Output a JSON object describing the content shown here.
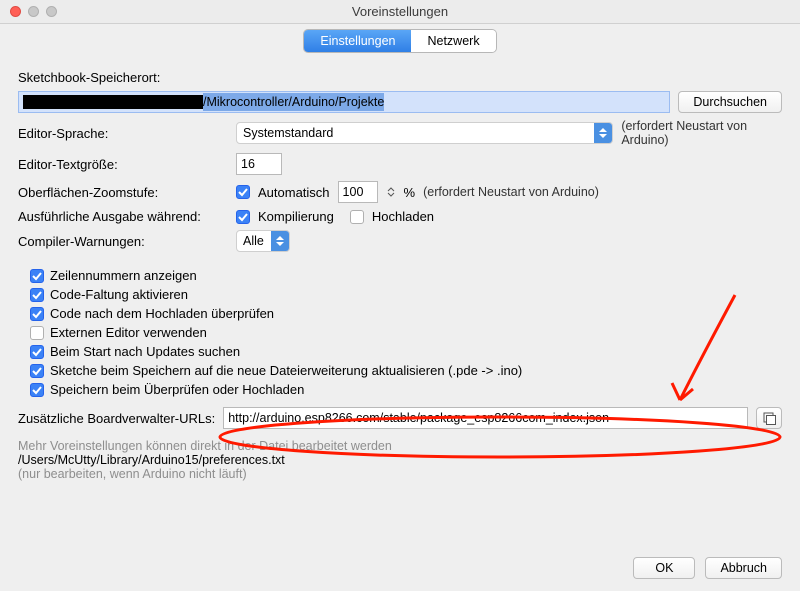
{
  "window": {
    "title": "Voreinstellungen"
  },
  "tabs": {
    "settings": "Einstellungen",
    "network": "Netzwerk"
  },
  "sketchbook": {
    "label": "Sketchbook-Speicherort:",
    "path_suffix": "/Mikrocontroller/Arduino/Projekte",
    "browse": "Durchsuchen"
  },
  "editor": {
    "language_label": "Editor-Sprache:",
    "language_value": "Systemstandard",
    "language_hint": "(erfordert Neustart von Arduino)",
    "fontsize_label": "Editor-Textgröße:",
    "fontsize_value": "16",
    "zoom_label": "Oberflächen-Zoomstufe:",
    "zoom_auto": "Automatisch",
    "zoom_value": "100",
    "zoom_pct": "%",
    "zoom_hint": "(erfordert Neustart von Arduino)"
  },
  "verbose": {
    "label": "Ausführliche Ausgabe während:",
    "compile": "Kompilierung",
    "upload": "Hochladen"
  },
  "warnings": {
    "label": "Compiler-Warnungen:",
    "value": "Alle"
  },
  "checkboxes": {
    "linenumbers": "Zeilennummern anzeigen",
    "folding": "Code-Faltung aktivieren",
    "verify_after_upload": "Code nach dem Hochladen überprüfen",
    "external_editor": "Externen Editor verwenden",
    "check_updates": "Beim Start nach Updates suchen",
    "update_ext": "Sketche beim Speichern auf die neue Dateierweiterung aktualisieren (.pde -> .ino)",
    "save_on_verify": "Speichern beim Überprüfen oder Hochladen"
  },
  "boards": {
    "label": "Zusätzliche Boardverwalter-URLs:",
    "value": "http://arduino.esp8266.com/stable/package_esp8266com_index.json"
  },
  "more": {
    "line1": "Mehr Voreinstellungen können direkt in der Datei bearbeitet werden",
    "line2": "/Users/McUtty/Library/Arduino15/preferences.txt",
    "line3": "(nur bearbeiten, wenn Arduino nicht läuft)"
  },
  "buttons": {
    "ok": "OK",
    "cancel": "Abbruch"
  }
}
